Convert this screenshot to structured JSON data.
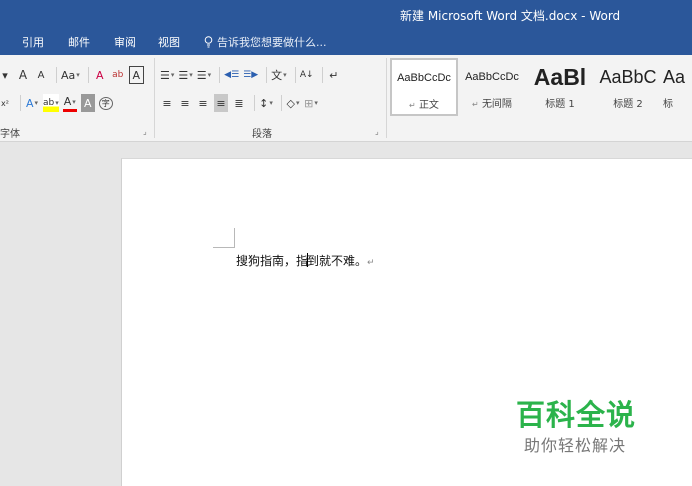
{
  "window": {
    "title": "新建 Microsoft Word 文档.docx - Word"
  },
  "tabs": [
    "引用",
    "邮件",
    "审阅",
    "视图"
  ],
  "tell_me": "告诉我您想要做什么...",
  "ribbon": {
    "font_group": {
      "label": "字体",
      "row1": [
        "▾",
        "A",
        "A",
        "Aa",
        "A",
        "ab",
        "A"
      ],
      "row2": [
        "x²",
        "A",
        "ab",
        "A",
        "A",
        "字"
      ]
    },
    "paragraph_group": {
      "label": "段落",
      "row1": [
        "☰",
        "☰",
        "☰",
        "◀☰",
        "☰▶",
        "文",
        "A↓",
        "↵"
      ],
      "row2": [
        "≡",
        "≡",
        "≡",
        "≡",
        "≣",
        "↕",
        "◇",
        "⊞"
      ]
    },
    "styles": [
      {
        "sample": "AaBbCcDc",
        "name": "正文",
        "mark": "↵"
      },
      {
        "sample": "AaBbCcDc",
        "name": "无间隔",
        "mark": "↵"
      },
      {
        "sample": "AaBl",
        "name": "标题 1"
      },
      {
        "sample": "AaBbC",
        "name": "标题 2"
      },
      {
        "sample": "Aa",
        "name": "标"
      }
    ]
  },
  "document": {
    "text_before_caret": "搜狗指南，指",
    "text_after_caret": "到就不难。",
    "paragraph_mark": "↵"
  },
  "watermark": {
    "title": "百科全说",
    "subtitle": "助你轻松解决"
  },
  "colors": {
    "title_bar": "#2b579a",
    "ribbon": "#f3f3f3",
    "watermark_green": "#2bb34b"
  }
}
